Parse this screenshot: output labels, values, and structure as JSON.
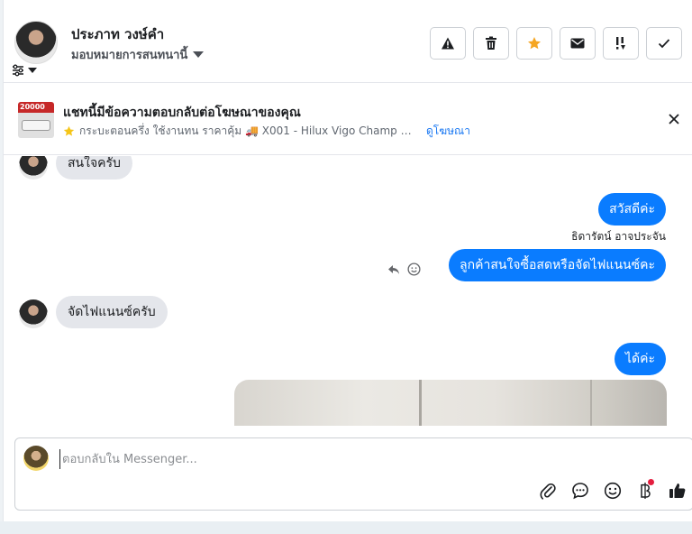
{
  "header": {
    "contact_name": "ประภาท วงษ์คำ",
    "assign_label": "มอบหมายการสนทนานี้",
    "toolbar": [
      {
        "icon": "warning-icon",
        "name": "spam-button"
      },
      {
        "icon": "trash-icon",
        "name": "delete-button"
      },
      {
        "icon": "star-icon",
        "name": "star-button"
      },
      {
        "icon": "envelope-icon",
        "name": "mark-unread-button"
      },
      {
        "icon": "follow-up-icon",
        "name": "follow-up-button"
      },
      {
        "icon": "check-icon",
        "name": "mark-done-button"
      }
    ],
    "star_color": "#f5a623"
  },
  "ad_banner": {
    "title": "แชทนี้มีข้อความตอบกลับต่อโฆษณาของคุณ",
    "thumb_price": "20000",
    "description": "กระบะตอนครึ่ง ใช้งานทน ราคาคุ้ม 🚚 X001 - Hilux Vigo Champ Ca...",
    "link_label": "ดูโฆษณา"
  },
  "messages": [
    {
      "direction": "in",
      "text": "สนใจครับ"
    },
    {
      "direction": "out",
      "text": "สวัสดีค่ะ"
    },
    {
      "direction": "out",
      "sender": "ธิดารัตน์ อาจประจัน",
      "text": "ลูกค้าสนใจซื้อสดหรือจัดไฟแนนซ์คะ"
    },
    {
      "direction": "in",
      "text": "จัดไฟแนนซ์ครับ"
    },
    {
      "direction": "out",
      "text": "ได้ค่ะ"
    }
  ],
  "composer": {
    "placeholder": "ตอบกลับใน Messenger..."
  },
  "colors": {
    "brand_blue": "#0a7cff",
    "link_blue": "#1877f2",
    "incoming_bubble": "#e4e6eb"
  }
}
